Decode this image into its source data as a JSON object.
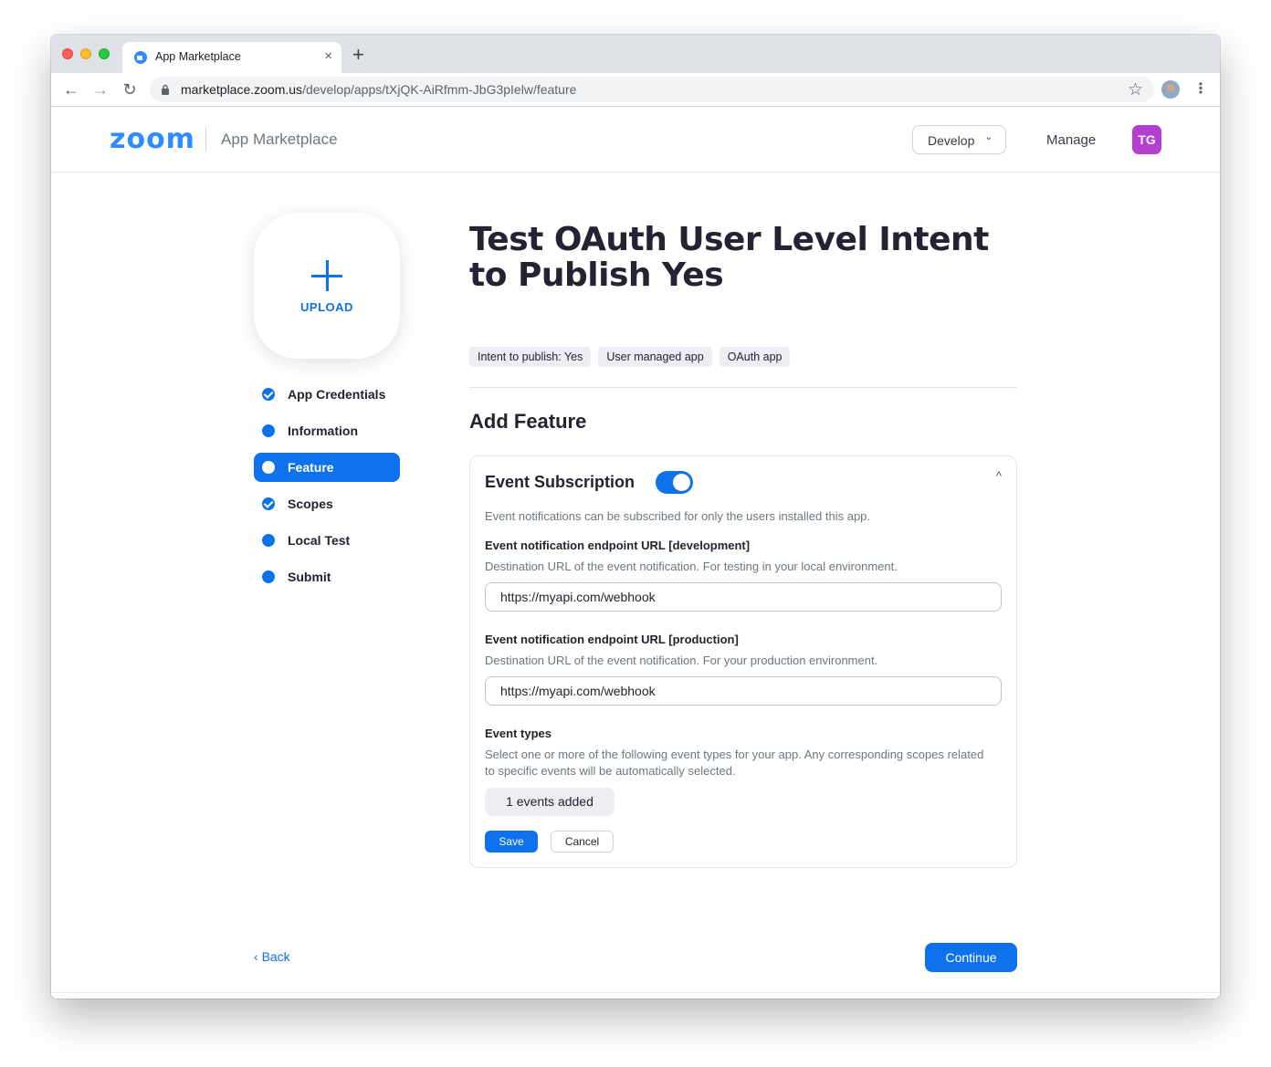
{
  "browser": {
    "tab_title": "App Marketplace",
    "tab_close": "×",
    "new_tab": "+",
    "url_host": "marketplace.zoom.us",
    "url_path": "/develop/apps/tXjQK-AiRfmm-JbG3pIelw/feature",
    "back": "←",
    "forward": "→",
    "reload": "↻",
    "star": "☆",
    "menu": "⋮"
  },
  "header": {
    "logo": "zoom",
    "subtitle": "App Marketplace",
    "develop_label": "Develop",
    "develop_chevron": "⌄",
    "manage_label": "Manage",
    "avatar_initials": "TG"
  },
  "sidebar": {
    "upload_label": "UPLOAD",
    "steps": [
      {
        "label": "App Credentials",
        "state": "done"
      },
      {
        "label": "Information",
        "state": "todo"
      },
      {
        "label": "Feature",
        "state": "active"
      },
      {
        "label": "Scopes",
        "state": "done"
      },
      {
        "label": "Local Test",
        "state": "todo"
      },
      {
        "label": "Submit",
        "state": "todo"
      }
    ]
  },
  "main": {
    "app_title": "Test OAuth User Level Intent to Publish Yes",
    "tags": [
      "Intent to publish: Yes",
      "User managed app",
      "OAuth app"
    ],
    "section_title": "Add Feature",
    "event_subscription": {
      "heading": "Event Subscription",
      "enabled": true,
      "collapse_icon": "^",
      "description": "Event notifications can be subscribed for only the users installed this app.",
      "dev_label": "Event notification endpoint URL [development]",
      "dev_help": "Destination URL of the event notification. For testing in your local environment.",
      "dev_value": "https://myapi.com/webhook",
      "prod_label": "Event notification endpoint URL [production]",
      "prod_help": "Destination URL of the event notification. For your production environment.",
      "prod_value": "https://myapi.com/webhook",
      "types_label": "Event types",
      "types_help": "Select one or more of the following event types for your app. Any corresponding scopes related to specific events will be automatically selected.",
      "events_added": "1 events added",
      "save_label": "Save",
      "cancel_label": "Cancel"
    }
  },
  "footer": {
    "back_label": "Back",
    "back_chevron": "‹",
    "continue_label": "Continue"
  },
  "colors": {
    "accent": "#0e72ed",
    "logo": "#2d8cff",
    "avatar": "#b43ed0",
    "text": "#232333"
  }
}
